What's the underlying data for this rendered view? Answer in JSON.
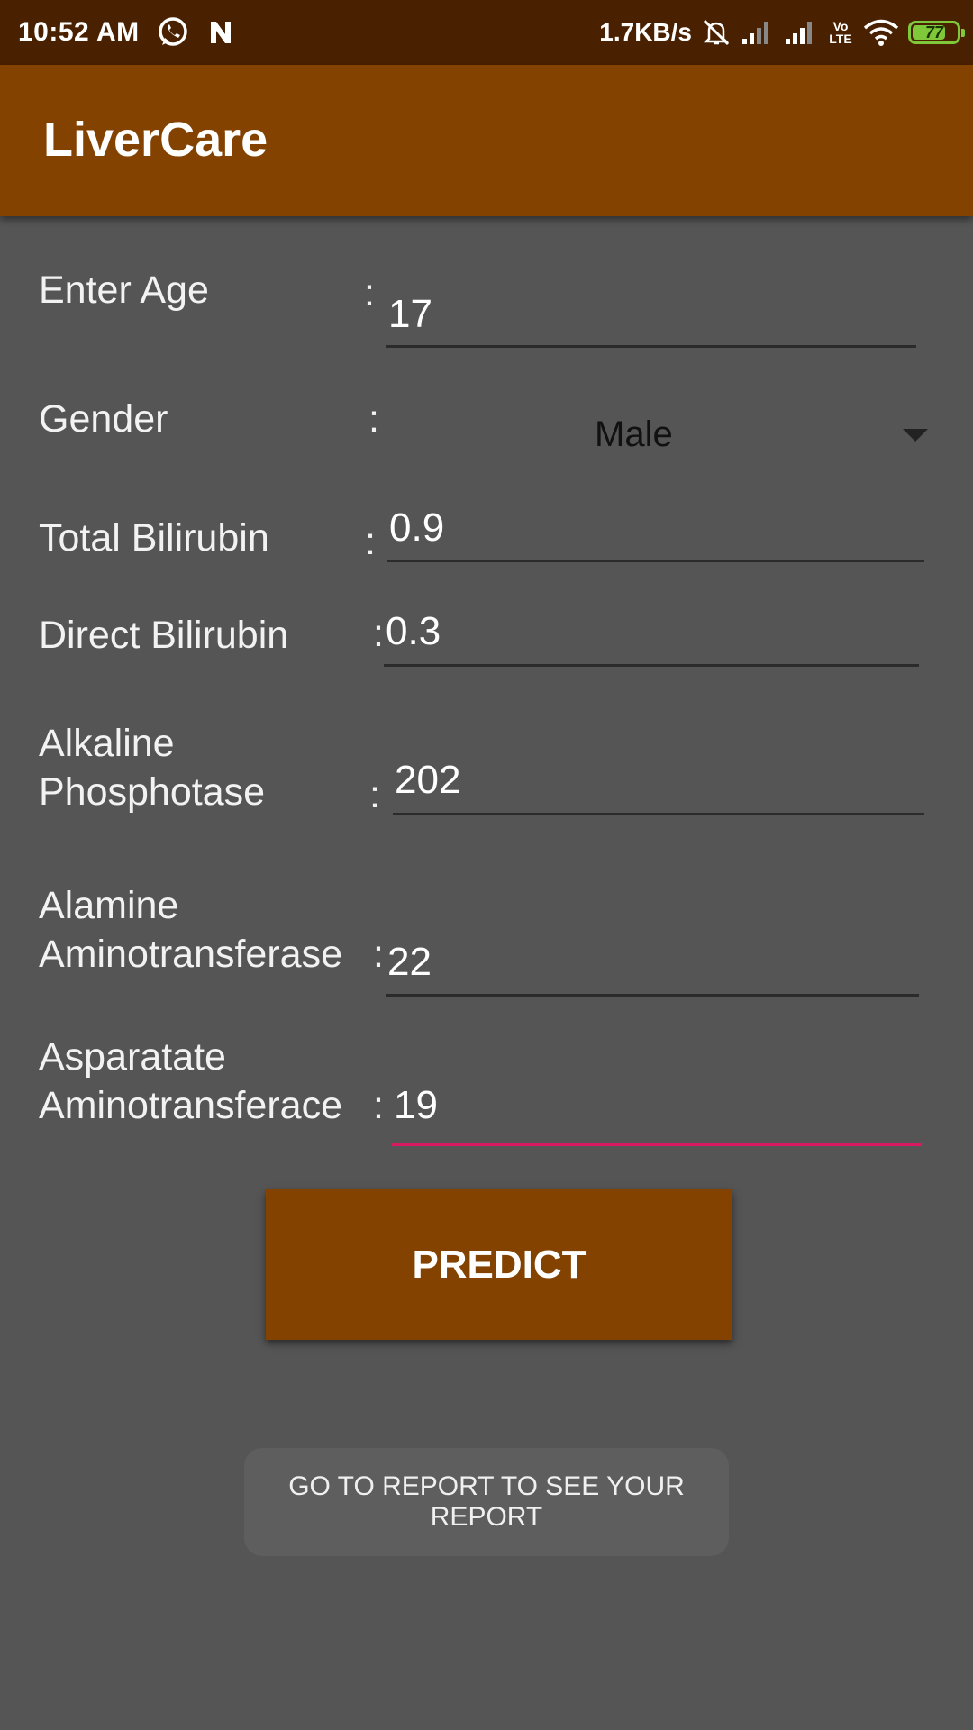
{
  "status_bar": {
    "time": "10:52 AM",
    "network_speed": "1.7KB/s",
    "lte_label": "Vo LTE",
    "battery_level": "77",
    "battery_fraction": 0.77,
    "icons": [
      "whatsapp-icon",
      "n-notification-icon",
      "mute-icon",
      "signal-icon",
      "signal-icon",
      "wifi-icon",
      "battery-icon"
    ]
  },
  "app_bar": {
    "title": "LiverCare"
  },
  "form": {
    "age": {
      "label": "Enter Age",
      "colon": ":",
      "value": "17"
    },
    "gender": {
      "label": "Gender",
      "colon": ":",
      "selected": "Male"
    },
    "total_bilirubin": {
      "label": "Total Bilirubin",
      "colon": ":",
      "value": "0.9"
    },
    "direct_bilirubin": {
      "label": "Direct Bilirubin",
      "colon": ":",
      "value": "0.3"
    },
    "alkaline_phosphotase": {
      "label_line1": "Alkaline",
      "label_line2": "Phosphotase",
      "colon": ":",
      "value": "202"
    },
    "alamine_aminotransferase": {
      "label_line1": "Alamine",
      "label_line2": "Aminotransferase",
      "colon": ":",
      "value": "22"
    },
    "asparatate_aminotransferace": {
      "label_line1": "Asparatate",
      "label_line2": "Aminotransferace",
      "colon": ":",
      "value": "19"
    }
  },
  "buttons": {
    "predict": "PREDICT",
    "report": "GO TO REPORT TO SEE YOUR REPORT"
  },
  "colors": {
    "status_bar": "#4a2100",
    "app_bar": "#834200",
    "background": "#555555",
    "accent_underline": "#d81b60",
    "battery": "#7ec83a"
  }
}
